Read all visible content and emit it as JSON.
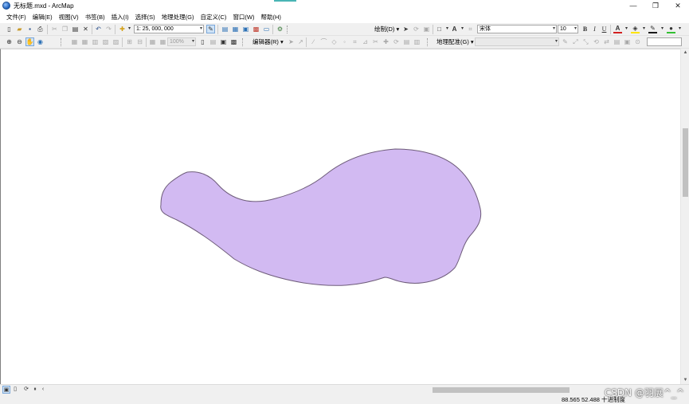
{
  "window": {
    "title": "无标题.mxd - ArcMap",
    "minimize": "—",
    "restore": "❐",
    "close": "✕"
  },
  "menu": {
    "items": [
      {
        "label": "文件(F)"
      },
      {
        "label": "编辑(E)"
      },
      {
        "label": "视图(V)"
      },
      {
        "label": "书签(B)"
      },
      {
        "label": "插入(I)"
      },
      {
        "label": "选择(S)"
      },
      {
        "label": "地理处理(G)"
      },
      {
        "label": "自定义(C)"
      },
      {
        "label": "窗口(W)"
      },
      {
        "label": "帮助(H)"
      }
    ]
  },
  "toolbar": {
    "scale_value": "1: 25, 000, 000",
    "drawing_menu": "绘制(D) ▾",
    "font_name": "宋体",
    "font_size": "10",
    "bold": "B",
    "italic": "I",
    "underline": "U",
    "font_color_glyph": "A",
    "zoom_percent": "100%",
    "editor_menu": "编辑器(R) ▾",
    "georef_menu": "地理配准(G) ▾"
  },
  "colors": {
    "polygon_fill": "#d2baf2",
    "polygon_stroke": "#6e5c7a",
    "font_color_bar": "#d22020",
    "highlight_color_bar": "#ffe400",
    "line_color_bar": "#1a1a1a",
    "marker_color_bar": "#33c033"
  },
  "map": {
    "feature": "polygon"
  },
  "status": {
    "coordinates": "88.565  52.488 十进制度"
  },
  "watermark": "CSDN @羽展^_^"
}
